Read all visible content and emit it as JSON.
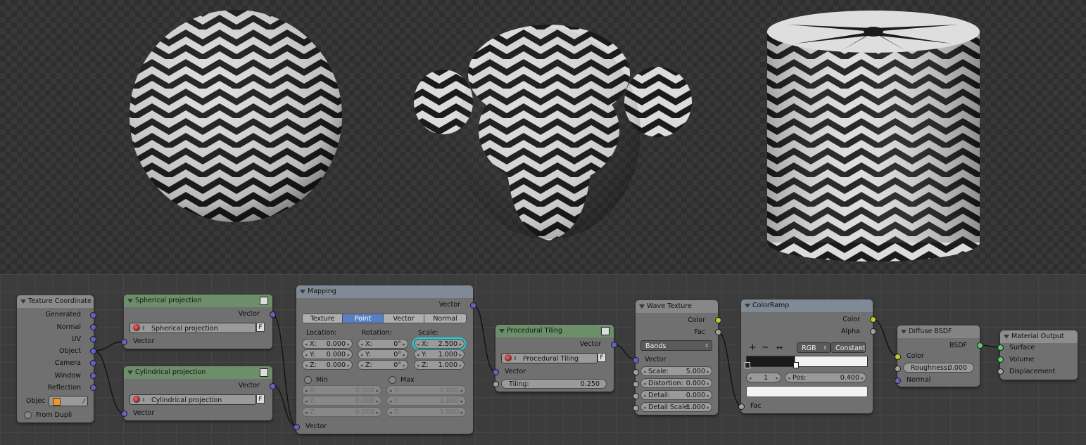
{
  "colors": {
    "vector_socket": "#6363c7",
    "color_socket": "#c7c729",
    "float_socket": "#a1a1a1",
    "shader_socket": "#63c763",
    "highlight": "#16d5e0",
    "active_tab": "#5680c2"
  },
  "texture_coordinate": {
    "title": "Texture Coordinate",
    "outputs": [
      "Generated",
      "Normal",
      "UV",
      "Object",
      "Camera",
      "Window",
      "Reflection"
    ],
    "object_label": "Objec",
    "object_icon": "cube-icon",
    "from_dupli": "From Dupli"
  },
  "spherical": {
    "title": "Spherical projection",
    "output": "Vector",
    "group_name": "Spherical projection",
    "fake_user": "F",
    "input": "Vector"
  },
  "cylindrical": {
    "title": "Cylindrical projection",
    "output": "Vector",
    "group_name": "Cylindrical projection",
    "fake_user": "F",
    "input": "Vector"
  },
  "mapping": {
    "title": "Mapping",
    "output": "Vector",
    "tabs": [
      "Texture",
      "Point",
      "Vector",
      "Normal"
    ],
    "active_tab": "Point",
    "location_label": "Location:",
    "rotation_label": "Rotation:",
    "scale_label": "Scale:",
    "location": [
      {
        "k": "X:",
        "v": "0.000"
      },
      {
        "k": "Y:",
        "v": "0.000"
      },
      {
        "k": "Z:",
        "v": "0.000"
      }
    ],
    "rotation": [
      {
        "k": "X:",
        "v": "0°"
      },
      {
        "k": "Y:",
        "v": "0°"
      },
      {
        "k": "Z:",
        "v": "0°"
      }
    ],
    "scale": [
      {
        "k": "X:",
        "v": "2.500"
      },
      {
        "k": "Y:",
        "v": "1.000"
      },
      {
        "k": "Z:",
        "v": "1.000"
      }
    ],
    "min_label": "Min",
    "max_label": "Max",
    "min": [
      {
        "k": "X:",
        "v": "0.000"
      },
      {
        "k": "Y:",
        "v": "0.000"
      },
      {
        "k": "Z:",
        "v": "0.000"
      }
    ],
    "max": [
      {
        "k": "X:",
        "v": "1.000"
      },
      {
        "k": "Y:",
        "v": "1.000"
      },
      {
        "k": "Z:",
        "v": "1.000"
      }
    ],
    "input": "Vector"
  },
  "procedural_tiling": {
    "title": "Procedural Tiling",
    "output": "Vector",
    "group_name": "Procedural Tiling",
    "fake_user": "F",
    "input": "Vector",
    "tiling_label": "Tiling:",
    "tiling_value": "0.250"
  },
  "wave_texture": {
    "title": "Wave Texture",
    "outputs": [
      "Color",
      "Fac"
    ],
    "type": "Bands",
    "input": "Vector",
    "fields": [
      {
        "k": "Scale:",
        "v": "5.000"
      },
      {
        "k": "Distortion:",
        "v": "0.000"
      },
      {
        "k": "Detail:",
        "v": "0.000"
      },
      {
        "k": "Detail Scale:",
        "v": "1.000"
      }
    ]
  },
  "color_ramp": {
    "title": "ColorRamp",
    "outputs": [
      "Color",
      "Alpha"
    ],
    "add": "+",
    "remove": "−",
    "flip": "↔",
    "mode": "RGB",
    "interpolation": "Constant",
    "stop_index": "1",
    "pos_label": "Pos:",
    "pos_value": "0.400",
    "input": "Fac"
  },
  "diffuse": {
    "title": "Diffuse BSDF",
    "output": "BSDF",
    "inputs": [
      "Color",
      "Normal"
    ],
    "roughness_label": "Roughness:",
    "roughness_value": "0.000"
  },
  "material_output": {
    "title": "Material Output",
    "inputs": [
      "Surface",
      "Volume",
      "Displacement"
    ]
  }
}
